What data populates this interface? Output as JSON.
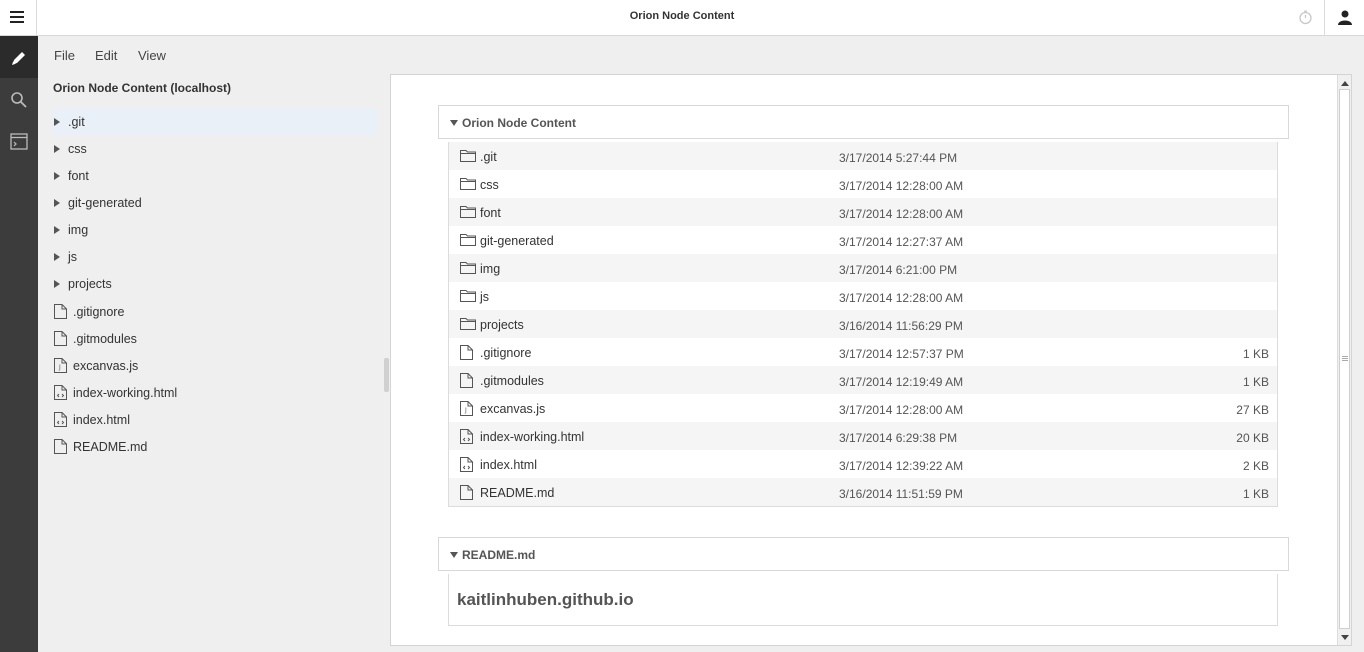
{
  "header": {
    "title": "Orion Node Content"
  },
  "menu": [
    "File",
    "Edit",
    "View"
  ],
  "sidebar": {
    "title": "Orion Node Content (localhost)",
    "items": [
      {
        "label": ".git",
        "type": "folder"
      },
      {
        "label": "css",
        "type": "folder"
      },
      {
        "label": "font",
        "type": "folder"
      },
      {
        "label": "git-generated",
        "type": "folder"
      },
      {
        "label": "img",
        "type": "folder"
      },
      {
        "label": "js",
        "type": "folder"
      },
      {
        "label": "projects",
        "type": "folder"
      },
      {
        "label": ".gitignore",
        "type": "file"
      },
      {
        "label": ".gitmodules",
        "type": "file"
      },
      {
        "label": "excanvas.js",
        "type": "js"
      },
      {
        "label": "index-working.html",
        "type": "html"
      },
      {
        "label": "index.html",
        "type": "html"
      },
      {
        "label": "README.md",
        "type": "file"
      }
    ]
  },
  "main": {
    "section_title": "Orion Node Content",
    "files": [
      {
        "name": ".git",
        "type": "folder",
        "date": "3/17/2014 5:27:44 PM",
        "size": ""
      },
      {
        "name": "css",
        "type": "folder",
        "date": "3/17/2014 12:28:00 AM",
        "size": ""
      },
      {
        "name": "font",
        "type": "folder",
        "date": "3/17/2014 12:28:00 AM",
        "size": ""
      },
      {
        "name": "git-generated",
        "type": "folder",
        "date": "3/17/2014 12:27:37 AM",
        "size": ""
      },
      {
        "name": "img",
        "type": "folder",
        "date": "3/17/2014 6:21:00 PM",
        "size": ""
      },
      {
        "name": "js",
        "type": "folder",
        "date": "3/17/2014 12:28:00 AM",
        "size": ""
      },
      {
        "name": "projects",
        "type": "folder",
        "date": "3/16/2014 11:56:29 PM",
        "size": ""
      },
      {
        "name": ".gitignore",
        "type": "file",
        "date": "3/17/2014 12:57:37 PM",
        "size": "1 KB"
      },
      {
        "name": ".gitmodules",
        "type": "file",
        "date": "3/17/2014 12:19:49 AM",
        "size": "1 KB"
      },
      {
        "name": "excanvas.js",
        "type": "js",
        "date": "3/17/2014 12:28:00 AM",
        "size": "27 KB"
      },
      {
        "name": "index-working.html",
        "type": "html",
        "date": "3/17/2014 6:29:38 PM",
        "size": "20 KB"
      },
      {
        "name": "index.html",
        "type": "html",
        "date": "3/17/2014 12:39:22 AM",
        "size": "2 KB"
      },
      {
        "name": "README.md",
        "type": "file",
        "date": "3/16/2014 11:51:59 PM",
        "size": "1 KB"
      }
    ],
    "readme_title": "README.md",
    "readme_heading": "kaitlinhuben.github.io"
  }
}
